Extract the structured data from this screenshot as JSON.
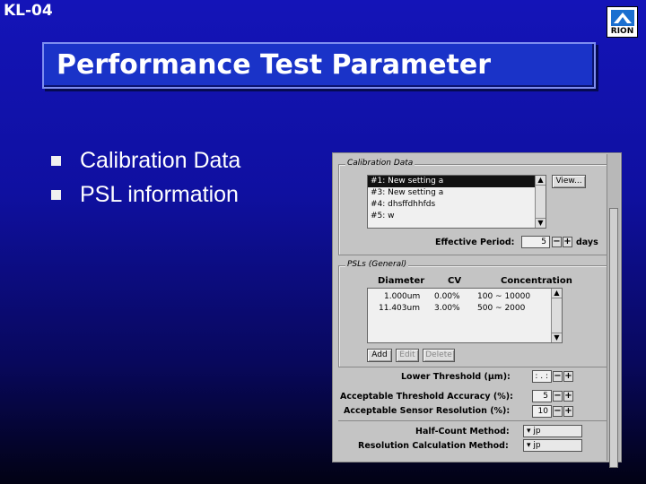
{
  "slide": {
    "id": "KL-04",
    "title": "Performance Test Parameter"
  },
  "logo": {
    "text": "RION"
  },
  "bullets": [
    "Calibration Data",
    "PSL information"
  ],
  "screenshot": {
    "calibration": {
      "group_title": "Calibration Data",
      "items": [
        "#1: New setting a",
        "#3: New setting a",
        "#4: dhsffdhhfds",
        "#5: w"
      ],
      "view_label": "View...",
      "effective_period_label": "Effective Period:",
      "effective_period_value": "5",
      "effective_period_unit": "days"
    },
    "psl": {
      "group_title": "PSLs (General)",
      "col_diameter": "Diameter",
      "col_cv": "CV",
      "col_concentration": "Concentration",
      "rows": [
        {
          "diameter": "1.000um",
          "cv": "0.00%",
          "concentration": "100 ~ 10000"
        },
        {
          "diameter": "11.403um",
          "cv": "3.00%",
          "concentration": "500 ~ 2000"
        }
      ],
      "add_label": "Add",
      "edit_label": "Edit",
      "delete_label": "Delete"
    },
    "lower_threshold_label": "Lower Threshold (μm):",
    "lower_threshold_value": ": . :",
    "accuracy_label": "Acceptable Threshold Accuracy (%):",
    "accuracy_value": "5",
    "resolution_label": "Acceptable Sensor Resolution (%):",
    "resolution_value": "10",
    "half_count_label": "Half-Count Method:",
    "half_count_value": "jp",
    "res_calc_label": "Resolution Calculation Method:",
    "res_calc_value": "jp"
  }
}
